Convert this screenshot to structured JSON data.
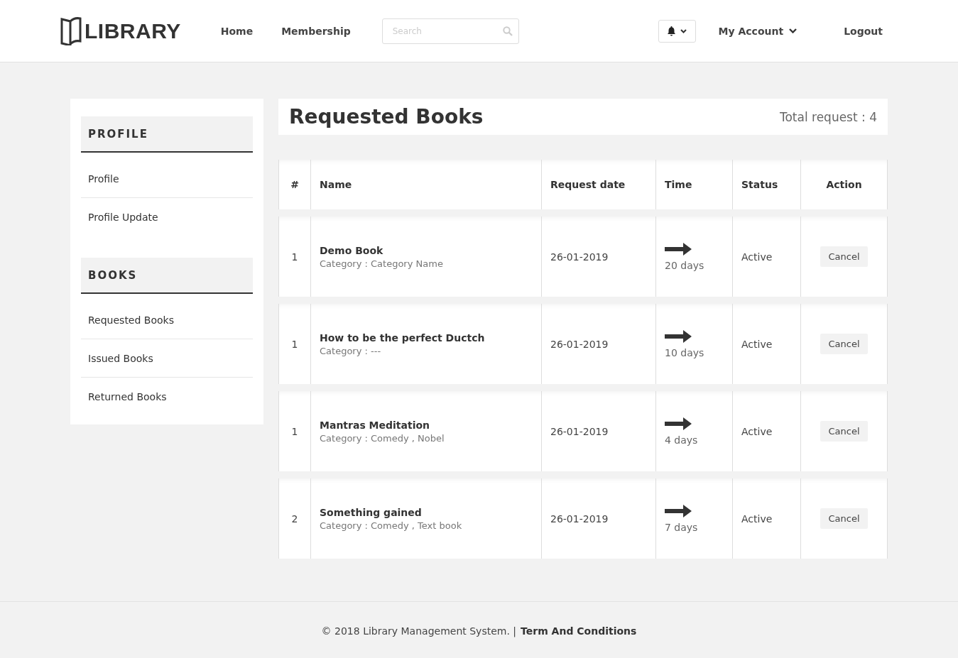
{
  "brand": {
    "name": "LIBRARY"
  },
  "nav": {
    "links": [
      "Home",
      "Membership"
    ],
    "search": {
      "placeholder": "Search"
    },
    "account": "My Account",
    "logout": "Logout"
  },
  "sidebar": {
    "sections": [
      {
        "title": "PROFILE",
        "items": [
          "Profile",
          "Profile Update"
        ]
      },
      {
        "title": "BOOKS",
        "items": [
          "Requested Books",
          "Issued Books",
          "Returned Books"
        ]
      }
    ]
  },
  "main": {
    "title": "Requested Books",
    "total": "Total request : 4",
    "table": {
      "columns": [
        "#",
        "Name",
        "Request date",
        "Time",
        "Status",
        "Action"
      ],
      "rows": [
        {
          "index": "1",
          "name": "Demo Book",
          "category": "Category : Category Name",
          "date": "26-01-2019",
          "time": "20 days",
          "status": "Active",
          "action": "Cancel"
        },
        {
          "index": "1",
          "name": "How to be the perfect Ductch",
          "category": "Category : ---",
          "date": "26-01-2019",
          "time": "10 days",
          "status": "Active",
          "action": "Cancel"
        },
        {
          "index": "1",
          "name": "Mantras Meditation",
          "category": "Category : Comedy , Nobel",
          "date": "26-01-2019",
          "time": "4 days",
          "status": "Active",
          "action": "Cancel"
        },
        {
          "index": "2",
          "name": "Something gained",
          "category": "Category : Comedy , Text book",
          "date": "26-01-2019",
          "time": "7 days",
          "status": "Active",
          "action": "Cancel"
        }
      ]
    }
  },
  "footer": {
    "text": "© 2018 Library Management System. |",
    "link": "Term And Conditions"
  }
}
